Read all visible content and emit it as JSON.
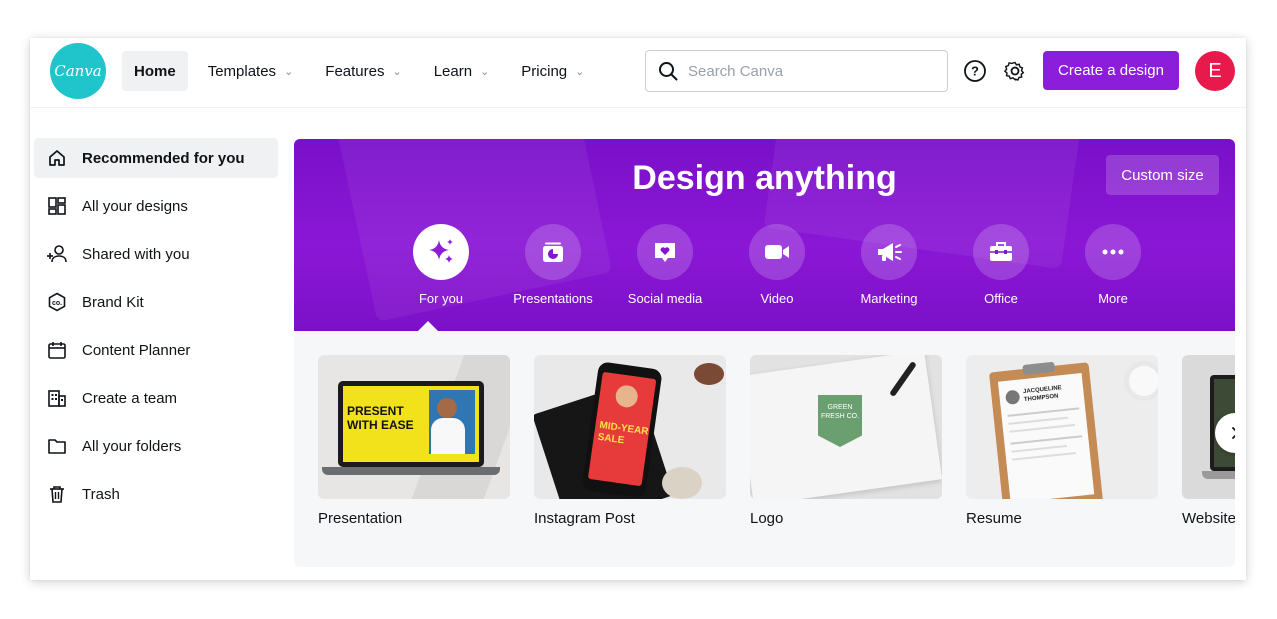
{
  "brand": {
    "logo_text": "Canva"
  },
  "nav": {
    "items": [
      {
        "label": "Home",
        "active": true,
        "dropdown": false
      },
      {
        "label": "Templates",
        "dropdown": true
      },
      {
        "label": "Features",
        "dropdown": true
      },
      {
        "label": "Learn",
        "dropdown": true
      },
      {
        "label": "Pricing",
        "dropdown": true
      }
    ]
  },
  "search": {
    "placeholder": "Search Canva",
    "icon": "search-icon"
  },
  "header": {
    "help_icon": "help-icon",
    "settings_icon": "gear-icon",
    "create_label": "Create a design",
    "avatar_initial": "E"
  },
  "sidebar": {
    "items": [
      {
        "label": "Recommended for you",
        "icon": "home-icon",
        "active": true
      },
      {
        "label": "All your designs",
        "icon": "grid-icon"
      },
      {
        "label": "Shared with you",
        "icon": "shared-users-icon"
      },
      {
        "label": "Brand Kit",
        "icon": "brand-kit-icon"
      },
      {
        "label": "Content Planner",
        "icon": "calendar-icon"
      },
      {
        "label": "Create a team",
        "icon": "building-icon"
      },
      {
        "label": "All your folders",
        "icon": "folder-icon"
      },
      {
        "label": "Trash",
        "icon": "trash-icon"
      }
    ]
  },
  "hero": {
    "title": "Design anything",
    "custom_size_label": "Custom size",
    "categories": [
      {
        "label": "For you",
        "icon": "sparkle-icon",
        "active": true
      },
      {
        "label": "Presentations",
        "icon": "presentation-icon"
      },
      {
        "label": "Social media",
        "icon": "heart-chat-icon"
      },
      {
        "label": "Video",
        "icon": "video-camera-icon"
      },
      {
        "label": "Marketing",
        "icon": "megaphone-icon"
      },
      {
        "label": "Office",
        "icon": "briefcase-icon"
      },
      {
        "label": "More",
        "icon": "more-dots-icon"
      }
    ]
  },
  "templates": {
    "cards": [
      {
        "label": "Presentation",
        "thumb_text": [
          "PRESENT",
          "WITH EASE"
        ]
      },
      {
        "label": "Instagram Post",
        "thumb_text": [
          "MID-YEAR",
          "SALE"
        ]
      },
      {
        "label": "Logo",
        "thumb_text": [
          "GREEN",
          "FRESH CO."
        ]
      },
      {
        "label": "Resume",
        "thumb_text": [
          "JACQUELINE",
          "THOMPSON"
        ]
      },
      {
        "label": "Website"
      }
    ],
    "next_icon": "chevron-right-icon"
  },
  "colors": {
    "accent": "#8b1ddb",
    "logo": "#20c4cb",
    "avatar": "#e8194b",
    "hero": "#8413d2"
  }
}
